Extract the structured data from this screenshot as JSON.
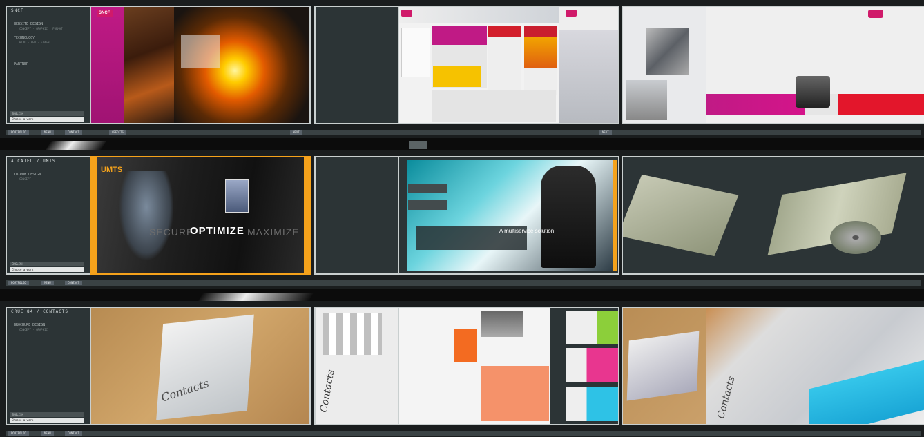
{
  "rows": [
    {
      "section_title": "SNCF",
      "menu_items": [
        {
          "label": "WEBSITE DESIGN",
          "sub": "CONCEPT · GRAPHIC · FORMAT"
        },
        {
          "label": "TECHNOLOGY",
          "sub": "HTML · PHP · FLASH"
        },
        {
          "label": "PARTNER"
        }
      ],
      "footer_label": "ENGLISH",
      "footer_sel": "Choose a work",
      "nav_buttons": [
        "PORTFOLIO",
        "MENU",
        "CONTACT",
        "CREDITS",
        "NEXT"
      ],
      "brand_logo": "SNCF"
    },
    {
      "section_title": "ALCATEL / UMTS",
      "menu_items": [
        {
          "label": "CD-ROM DESIGN",
          "sub": "CONCEPT"
        }
      ],
      "footer_label": "ENGLISH",
      "footer_sel": "Choose a work",
      "nav_buttons": [
        "PORTFOLIO",
        "MENU",
        "CONTACT"
      ],
      "banner_title": "UMTS",
      "banner_words": [
        "SECURE",
        "OPTIMIZE",
        "MAXIMIZE"
      ],
      "screen_tagline": "A multiservice solution"
    },
    {
      "section_title": "CRUE 84 / CONTACTS",
      "menu_items": [
        {
          "label": "BROCHURE DESIGN",
          "sub": "CONCEPT · GRAPHIC"
        }
      ],
      "footer_label": "ENGLISH",
      "footer_sel": "Choose a work",
      "nav_buttons": [
        "PORTFOLIO",
        "MENU",
        "CONTACT"
      ],
      "brochure_word": "Contacts"
    }
  ],
  "colors": {
    "panel": "#2c3436",
    "frame_border": "#c9cfcf",
    "sncf_magenta": "#d4148a",
    "umts_orange": "#f5a21b",
    "brochure_orange": "#f36b21"
  }
}
